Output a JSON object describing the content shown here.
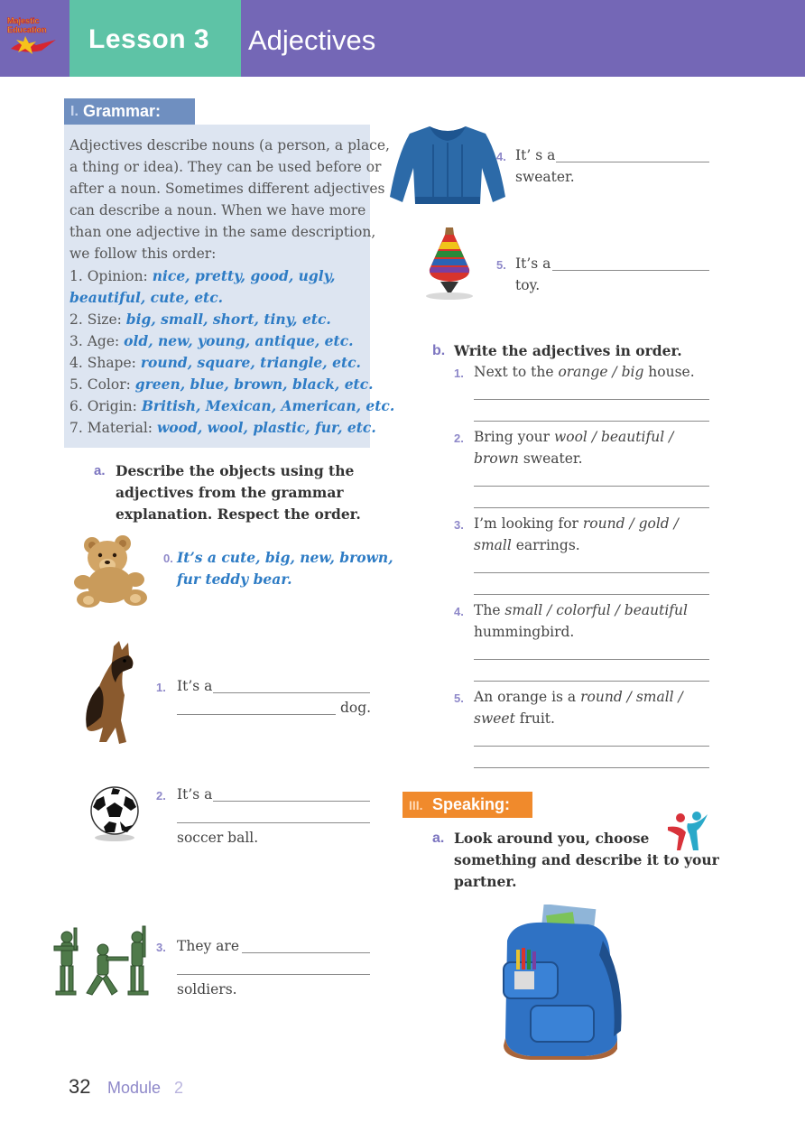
{
  "header": {
    "logo_text_1": "Majestic",
    "logo_text_2": "Education",
    "lesson_label": "Lesson 3",
    "lesson_title": "Adjectives"
  },
  "grammar": {
    "section_number": "I.",
    "title": "Grammar:",
    "intro_lines": [
      "Adjectives describe nouns (a person, a place,",
      "a thing or idea). They can be used before or",
      "after a noun. Sometimes different adjectives",
      "can describe a noun. When we have more",
      "than one adjective in the same description,",
      "we follow this order:"
    ],
    "order": [
      {
        "label": "1. Opinion:",
        "examples": "nice, pretty, good, ugly,"
      },
      {
        "label": "",
        "examples": "beautiful, cute, etc."
      },
      {
        "label": "2. Size:",
        "examples": "big, small, short, tiny, etc."
      },
      {
        "label": "3. Age:",
        "examples": "old, new, young, antique, etc."
      },
      {
        "label": "4. Shape:",
        "examples": "round, square, triangle, etc."
      },
      {
        "label": "5. Color:",
        "examples": "green, blue, brown, black, etc."
      },
      {
        "label": "6. Origin:",
        "examples": "British, Mexican, American, etc."
      },
      {
        "label": "7. Material:",
        "examples": "wood, wool, plastic, fur, etc."
      }
    ]
  },
  "exercise_a": {
    "letter": "a.",
    "instruction_lines": [
      "Describe the objects using the",
      "adjectives from the grammar",
      "explanation. Respect the order."
    ],
    "example": {
      "num": "0.",
      "lines": [
        "It’s a cute, big, new, brown,",
        "fur teddy bear."
      ]
    },
    "items": [
      {
        "num": "1.",
        "start": "It’s a",
        "end": "dog."
      },
      {
        "num": "2.",
        "start": "It’s a",
        "end": "soccer ball."
      },
      {
        "num": "3.",
        "start": "They are",
        "end": "soldiers."
      },
      {
        "num": "4.",
        "start": "It’ s a",
        "end": "sweater."
      },
      {
        "num": "5.",
        "start": "It’s a",
        "end": "toy."
      }
    ]
  },
  "exercise_b": {
    "letter": "b.",
    "instruction": "Write the adjectives in order.",
    "items": [
      {
        "num": "1.",
        "line1": {
          "pre": "Next to the ",
          "it": "orange / big",
          "post": " house."
        }
      },
      {
        "num": "2.",
        "line1": {
          "pre": "Bring your ",
          "it": "wool / beautiful /",
          "post": ""
        },
        "line2": {
          "pre": "",
          "it": "brown",
          "post": " sweater."
        }
      },
      {
        "num": "3.",
        "line1": {
          "pre": "I’m looking for ",
          "it": "round / gold /",
          "post": ""
        },
        "line2": {
          "pre": "",
          "it": "small",
          "post": " earrings."
        }
      },
      {
        "num": "4.",
        "line1": {
          "pre": "The ",
          "it": "small / colorful / beautiful",
          "post": ""
        },
        "line2": {
          "pre": "hummingbird.",
          "it": "",
          "post": ""
        }
      },
      {
        "num": "5.",
        "line1": {
          "pre": "An orange is a ",
          "it": "round / small /",
          "post": ""
        },
        "line2": {
          "pre": "",
          "it": "sweet",
          "post": " fruit."
        }
      }
    ]
  },
  "speaking": {
    "section_number": "III.",
    "title": "Speaking:",
    "letter": "a.",
    "instruction_lines": [
      "Look around you, choose",
      "something and describe it to your",
      "partner."
    ]
  },
  "footer": {
    "page_number": "32",
    "module_label": "Module",
    "module_number": "2"
  },
  "colors": {
    "header_purple": "#7467b6",
    "lesson_green": "#5ec3a6",
    "grammar_blue": "#6f8fc0",
    "grammar_box": "#dde5f1",
    "example_blue": "#2e7cc5",
    "speaking_orange": "#f08a2c",
    "number_purple": "#8e88c9"
  }
}
